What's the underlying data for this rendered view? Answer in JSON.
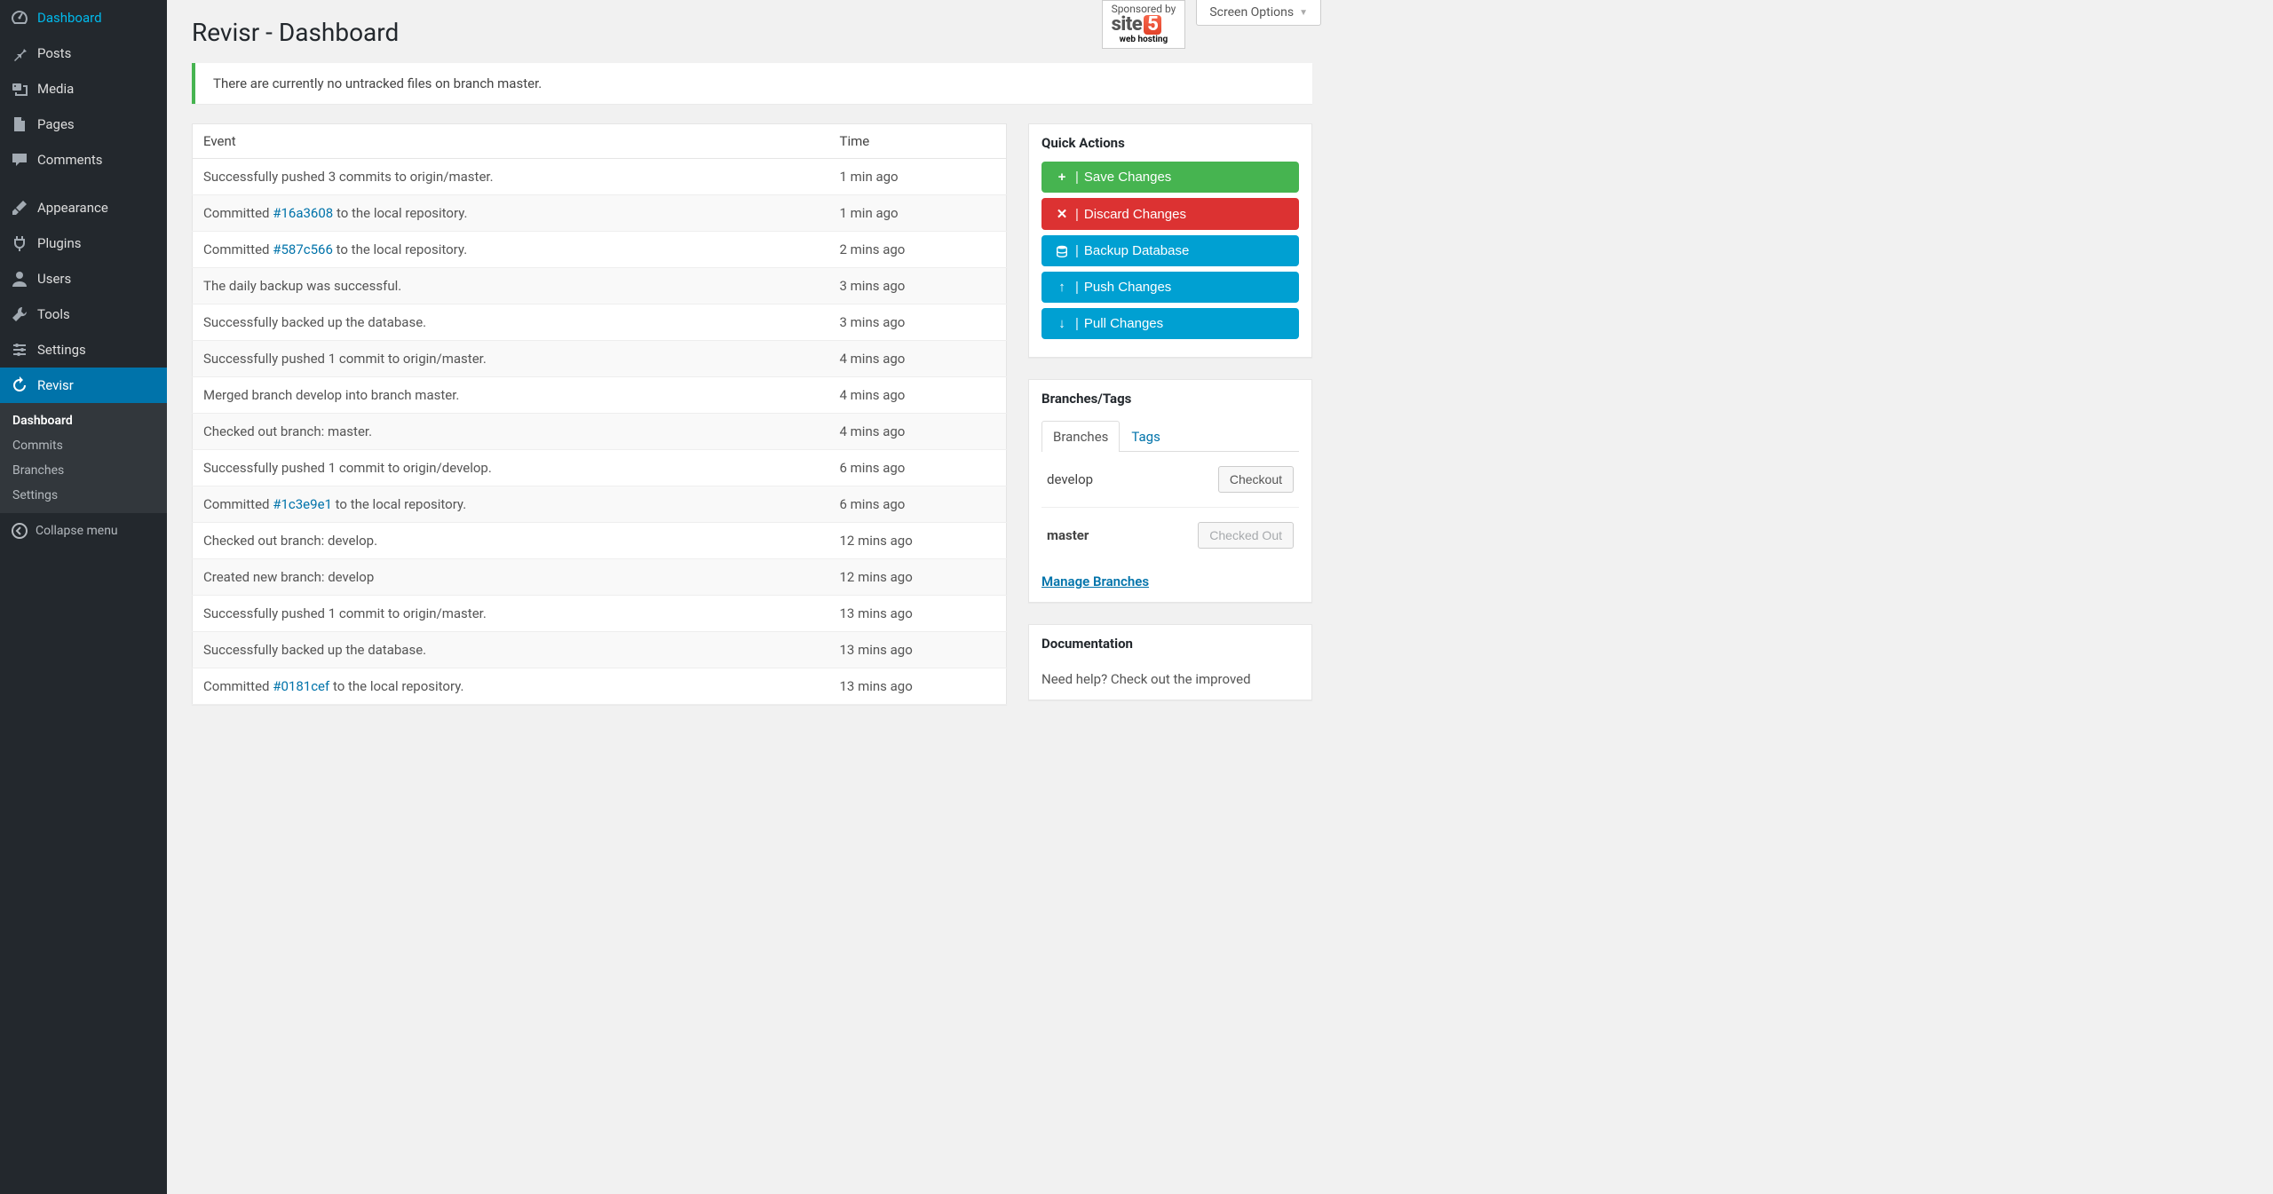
{
  "sidebar": {
    "items": [
      {
        "label": "Dashboard",
        "icon": "dashboard"
      },
      {
        "label": "Posts",
        "icon": "pin"
      },
      {
        "label": "Media",
        "icon": "media"
      },
      {
        "label": "Pages",
        "icon": "page"
      },
      {
        "label": "Comments",
        "icon": "comment"
      },
      {
        "label": "Appearance",
        "icon": "brush"
      },
      {
        "label": "Plugins",
        "icon": "plug"
      },
      {
        "label": "Users",
        "icon": "user"
      },
      {
        "label": "Tools",
        "icon": "wrench"
      },
      {
        "label": "Settings",
        "icon": "sliders"
      },
      {
        "label": "Revisr",
        "icon": "revisr",
        "active": true
      }
    ],
    "submenu": [
      {
        "label": "Dashboard",
        "current": true
      },
      {
        "label": "Commits"
      },
      {
        "label": "Branches"
      },
      {
        "label": "Settings"
      }
    ],
    "collapse": "Collapse menu"
  },
  "header": {
    "sponsored_by": "Sponsored by",
    "sponsor_brand": "site",
    "sponsor_five": "5",
    "sponsor_tag": "web hosting",
    "screen_options": "Screen Options"
  },
  "page": {
    "title": "Revisr - Dashboard",
    "notice": "There are currently no untracked files on branch master."
  },
  "events": {
    "header_event": "Event",
    "header_time": "Time",
    "rows": [
      {
        "prefix": "Successfully pushed 3 commits to origin/master.",
        "link": "",
        "suffix": "",
        "time": "1 min ago"
      },
      {
        "prefix": "Committed ",
        "link": "#16a3608",
        "suffix": " to the local repository.",
        "time": "1 min ago"
      },
      {
        "prefix": "Committed ",
        "link": "#587c566",
        "suffix": " to the local repository.",
        "time": "2 mins ago"
      },
      {
        "prefix": "The daily backup was successful.",
        "link": "",
        "suffix": "",
        "time": "3 mins ago"
      },
      {
        "prefix": "Successfully backed up the database.",
        "link": "",
        "suffix": "",
        "time": "3 mins ago"
      },
      {
        "prefix": "Successfully pushed 1 commit to origin/master.",
        "link": "",
        "suffix": "",
        "time": "4 mins ago"
      },
      {
        "prefix": "Merged branch develop into branch master.",
        "link": "",
        "suffix": "",
        "time": "4 mins ago"
      },
      {
        "prefix": "Checked out branch: master.",
        "link": "",
        "suffix": "",
        "time": "4 mins ago"
      },
      {
        "prefix": "Successfully pushed 1 commit to origin/develop.",
        "link": "",
        "suffix": "",
        "time": "6 mins ago"
      },
      {
        "prefix": "Committed ",
        "link": "#1c3e9e1",
        "suffix": " to the local repository.",
        "time": "6 mins ago"
      },
      {
        "prefix": "Checked out branch: develop.",
        "link": "",
        "suffix": "",
        "time": "12 mins ago"
      },
      {
        "prefix": "Created new branch: develop",
        "link": "",
        "suffix": "",
        "time": "12 mins ago"
      },
      {
        "prefix": "Successfully pushed 1 commit to origin/master.",
        "link": "",
        "suffix": "",
        "time": "13 mins ago"
      },
      {
        "prefix": "Successfully backed up the database.",
        "link": "",
        "suffix": "",
        "time": "13 mins ago"
      },
      {
        "prefix": "Committed ",
        "link": "#0181cef",
        "suffix": " to the local repository.",
        "time": "13 mins ago"
      }
    ]
  },
  "quick_actions": {
    "title": "Quick Actions",
    "save": "Save Changes",
    "discard": "Discard Changes",
    "backup": "Backup Database",
    "push": "Push Changes",
    "pull": "Pull Changes"
  },
  "branches_box": {
    "title": "Branches/Tags",
    "tab_branches": "Branches",
    "tab_tags": "Tags",
    "rows": [
      {
        "name": "develop",
        "btn": "Checkout",
        "current": false
      },
      {
        "name": "master",
        "btn": "Checked Out",
        "current": true
      }
    ],
    "manage": "Manage Branches"
  },
  "documentation": {
    "title": "Documentation",
    "text": "Need help? Check out the improved"
  }
}
